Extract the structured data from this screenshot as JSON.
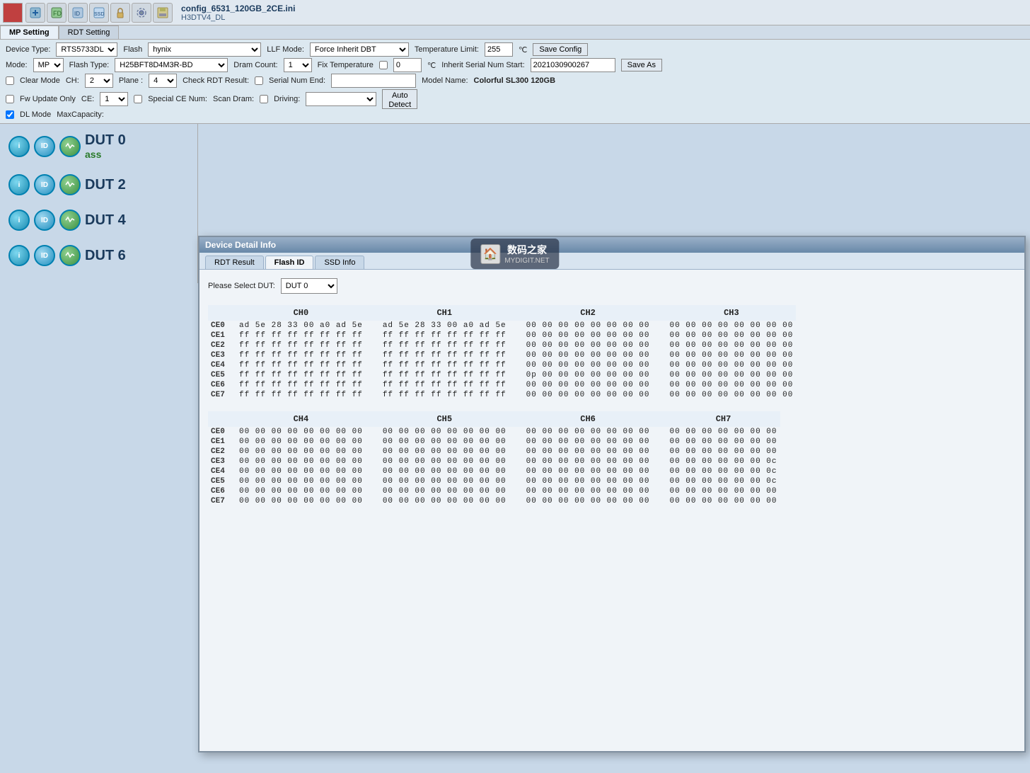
{
  "window": {
    "title": "config_6531_120GB_2CE.ini",
    "subtitle": "H3DTV4_DL"
  },
  "toolbar": {
    "icons": [
      "rdt-result",
      "factory-defect",
      "read-id",
      "ssd-info",
      "lock",
      "settings",
      "save"
    ]
  },
  "tabs": {
    "mp_setting": "MP Setting",
    "rdt_setting": "RDT Setting"
  },
  "settings": {
    "device_type_label": "Device Type:",
    "device_type_value": "RTS5733DL",
    "mode_label": "Mode:",
    "mode_value": "MP",
    "flash_label": "Flash",
    "flash_value": "hynix",
    "flash_type_label": "Flash Type:",
    "flash_type_value": "H25BFT8D4M3R-BD",
    "ch_label": "CH:",
    "ch_value": "2",
    "plane_label": "Plane :",
    "plane_value": "4",
    "ce_label": "CE:",
    "ce_value": "1",
    "special_ce_num_label": "Special CE Num:",
    "driving_label": "Driving:",
    "llf_mode_label": "LLF Mode:",
    "llf_mode_value": "Force Inherit DBT",
    "dram_count_label": "Dram Count:",
    "dram_count_value": "1",
    "check_rdt_label": "Check RDT Result:",
    "scan_dram_label": "Scan Dram:",
    "temp_limit_label": "Temperature Limit:",
    "temp_limit_value": "255",
    "temp_unit": "℃",
    "fix_temp_label": "Fix Temperature",
    "fix_temp_value": "0",
    "inherit_serial_label": "Inherit Serial Num Start:",
    "inherit_serial_value": "2021030900267",
    "serial_end_label": "Serial Num End:",
    "model_name_label": "Model Name:",
    "model_name_value": "Colorful SL300 120GB",
    "clear_mode_label": "Clear Mode",
    "fw_update_only_label": "Fw Update Only",
    "dl_mode_label": "DL Mode",
    "auto_detect_label": "Auto\nDetect",
    "max_capacity_label": "MaxCapacity:",
    "save_config_label": "Save Config",
    "save_as_label": "Save As"
  },
  "dut_list": [
    {
      "id": 0,
      "label": "DUT 0",
      "status": "ass",
      "icons": [
        "info",
        "id",
        "activity"
      ]
    },
    {
      "id": 2,
      "label": "DUT 2",
      "status": "",
      "icons": [
        "info",
        "id",
        "activity"
      ]
    },
    {
      "id": 4,
      "label": "DUT 4",
      "status": "",
      "icons": [
        "info",
        "id",
        "activity"
      ]
    },
    {
      "id": 6,
      "label": "DUT 6",
      "status": "",
      "icons": [
        "info",
        "id",
        "activity"
      ]
    }
  ],
  "dialog": {
    "title": "Device Detail Info",
    "tabs": [
      "RDT Result",
      "Flash ID",
      "SSD Info"
    ],
    "active_tab": "Flash ID",
    "select_dut_label": "Please Select DUT:",
    "select_dut_value": "DUT 0",
    "channels_top": [
      "CH0",
      "CH1",
      "CH2",
      "CH3"
    ],
    "channels_bottom": [
      "CH4",
      "CH5",
      "CH6",
      "CH7"
    ],
    "ce_rows": [
      "CE0",
      "CE1",
      "CE2",
      "CE3",
      "CE4",
      "CE5",
      "CE6",
      "CE7"
    ],
    "flash_data_top": {
      "CH0": {
        "CE0": "ad 5e 28 33 00 a0 ad 5e",
        "CE1": "ff ff ff ff ff ff ff ff",
        "CE2": "ff ff ff ff ff ff ff ff",
        "CE3": "ff ff ff ff ff ff ff ff",
        "CE4": "ff ff ff ff ff ff ff ff",
        "CE5": "ff ff ff ff ff ff ff ff",
        "CE6": "ff ff ff ff ff ff ff ff",
        "CE7": "ff ff ff ff ff ff ff ff"
      },
      "CH1": {
        "CE0": "ad 5e 28 33 00 a0 ad 5e",
        "CE1": "ff ff ff ff ff ff ff ff",
        "CE2": "ff ff ff ff ff ff ff ff",
        "CE3": "ff ff ff ff ff ff ff ff",
        "CE4": "ff ff ff ff ff ff ff ff",
        "CE5": "ff ff ff ff ff ff ff ff",
        "CE6": "ff ff ff ff ff ff ff ff",
        "CE7": "ff ff ff ff ff ff ff ff"
      },
      "CH2": {
        "CE0": "00 00 00 00 00 00 00 00",
        "CE1": "00 00 00 00 00 00 00 00",
        "CE2": "00 00 00 00 00 00 00 00",
        "CE3": "00 00 00 00 00 00 00 00",
        "CE4": "00 00 00 00 00 00 00 00",
        "CE5": "0p 00 00 00 00 00 00 00",
        "CE6": "00 00 00 00 00 00 00 00",
        "CE7": "00 00 00 00 00 00 00 00"
      },
      "CH3": {
        "CE0": "00 00 00 00 00 00 00 00",
        "CE1": "00 00 00 00 00 00 00 00",
        "CE2": "00 00 00 00 00 00 00 00",
        "CE3": "00 00 00 00 00 00 00 00",
        "CE4": "00 00 00 00 00 00 00 00",
        "CE5": "00 00 00 00 00 00 00 00",
        "CE6": "00 00 00 00 00 00 00 00",
        "CE7": "00 00 00 00 00 00 00 00"
      }
    },
    "flash_data_bottom": {
      "CH4": {
        "CE0": "00 00 00 00 00 00 00 00",
        "CE1": "00 00 00 00 00 00 00 00",
        "CE2": "00 00 00 00 00 00 00 00",
        "CE3": "00 00 00 00 00 00 00 00",
        "CE4": "00 00 00 00 00 00 00 00",
        "CE5": "00 00 00 00 00 00 00 00",
        "CE6": "00 00 00 00 00 00 00 00",
        "CE7": "00 00 00 00 00 00 00 00"
      },
      "CH5": {
        "CE0": "00 00 00 00 00 00 00 00",
        "CE1": "00 00 00 00 00 00 00 00",
        "CE2": "00 00 00 00 00 00 00 00",
        "CE3": "00 00 00 00 00 00 00 00",
        "CE4": "00 00 00 00 00 00 00 00",
        "CE5": "00 00 00 00 00 00 00 00",
        "CE6": "00 00 00 00 00 00 00 00",
        "CE7": "00 00 00 00 00 00 00 00"
      },
      "CH6": {
        "CE0": "00 00 00 00 00 00 00 00",
        "CE1": "00 00 00 00 00 00 00 00",
        "CE2": "00 00 00 00 00 00 00 00",
        "CE3": "00 00 00 00 00 00 00 00",
        "CE4": "00 00 00 00 00 00 00 00",
        "CE5": "00 00 00 00 00 00 00 00",
        "CE6": "00 00 00 00 00 00 00 00",
        "CE7": "00 00 00 00 00 00 00 00"
      },
      "CH7": {
        "CE0": "00 00 00 00 00 00 00",
        "CE1": "00 00 00 00 00 00 00",
        "CE2": "00 00 00 00 00 00 00",
        "CE3": "00 00 00 00 00 00 0c",
        "CE4": "00 00 00 00 00 00 0c",
        "CE5": "00 00 00 00 00 00 0c",
        "CE6": "00 00 00 00 00 00 00",
        "CE7": "00 00 00 00 00 00 00"
      }
    }
  },
  "watermark": {
    "main": "数码之家",
    "sub": "MYDIGIT.NET"
  }
}
